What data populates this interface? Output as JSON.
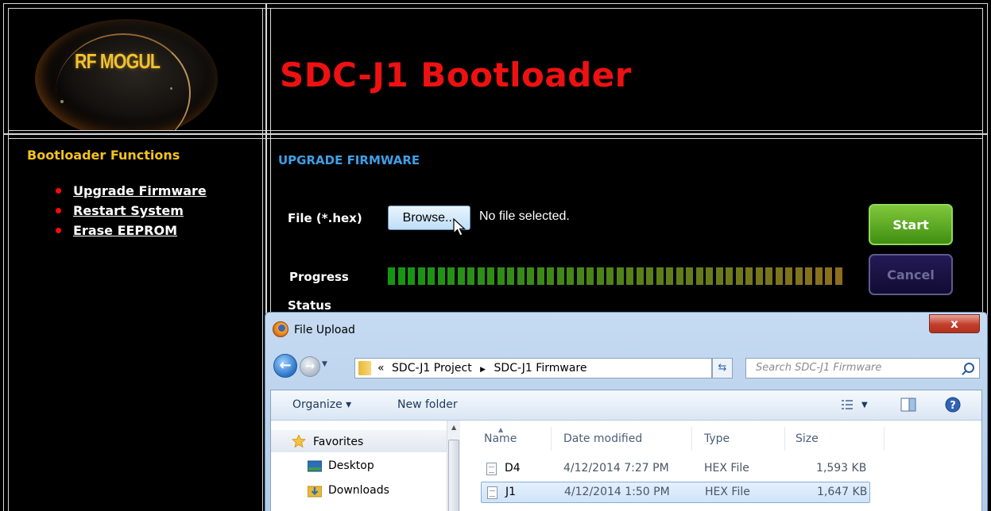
{
  "header": {
    "logo_text": "RF MOGUL",
    "title": "SDC-J1 Bootloader"
  },
  "sidebar": {
    "title": "Bootloader Functions",
    "items": [
      {
        "label": "Upgrade Firmware"
      },
      {
        "label": "Restart System"
      },
      {
        "label": "Erase EEPROM"
      }
    ]
  },
  "main": {
    "section_title": "UPGRADE FIRMWARE",
    "file_label": "File (*.hex)",
    "browse_label": "Browse...",
    "file_status": "No file selected.",
    "start_label": "Start",
    "cancel_label": "Cancel",
    "progress_label": "Progress",
    "status_label": "Status",
    "progress_fraction": 1.0
  },
  "dialog": {
    "title": "File Upload",
    "close_label": "x",
    "address_prefix": "«",
    "path": [
      "SDC-J1 Project",
      "SDC-J1 Firmware"
    ],
    "search_placeholder": "Search SDC-J1 Firmware",
    "toolbar": {
      "organize_label": "Organize ▾",
      "new_folder_label": "New folder"
    },
    "nav": [
      {
        "label": "Favorites",
        "icon": "star-icon"
      },
      {
        "label": "Desktop",
        "icon": "desktop-icon"
      },
      {
        "label": "Downloads",
        "icon": "downloads-folder-icon"
      }
    ],
    "columns": [
      "Name",
      "Date modified",
      "Type",
      "Size"
    ],
    "files": [
      {
        "name": "D4",
        "date": "4/12/2014 7:27 PM",
        "type": "HEX File",
        "size": "1,593 KB",
        "selected": false
      },
      {
        "name": "J1",
        "date": "4/12/2014 1:50 PM",
        "type": "HEX File",
        "size": "1,647 KB",
        "selected": true
      }
    ]
  },
  "colors": {
    "title_red": "#ee1111",
    "sidebar_title_yellow": "#f4c21c",
    "section_blue": "#3f9fe6",
    "start_green": "#5aa92a",
    "cancel_navy": "#1c1448"
  }
}
